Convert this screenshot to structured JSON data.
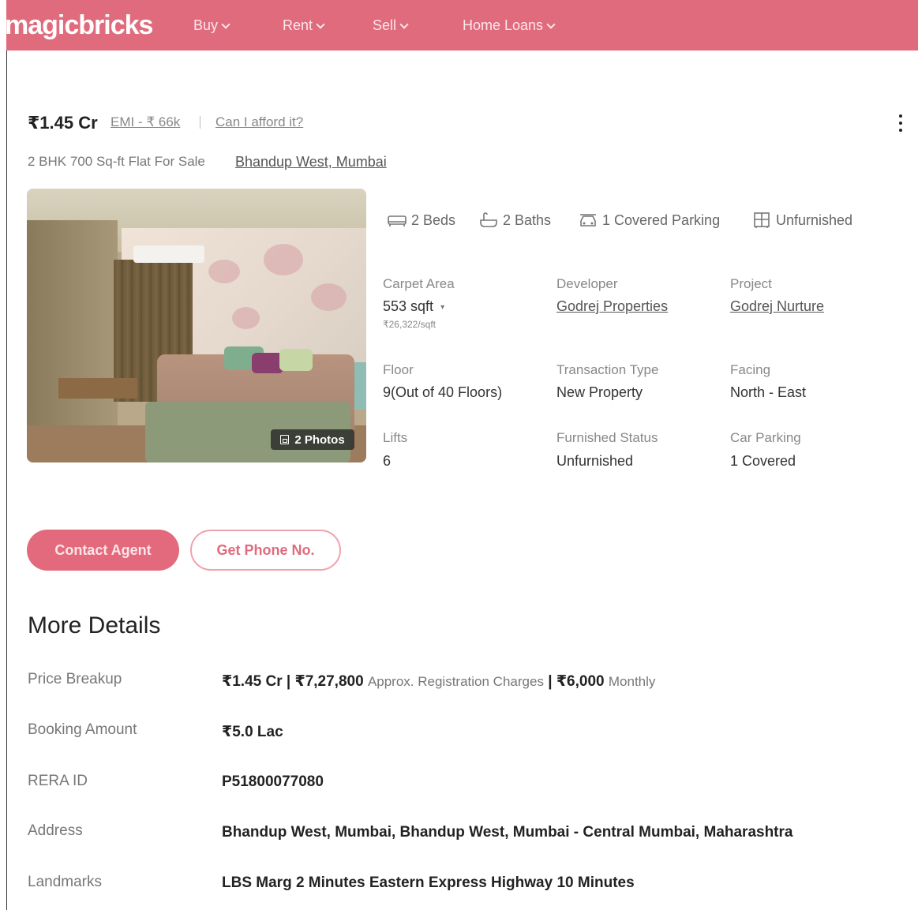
{
  "header": {
    "logo": "magicbricks",
    "nav": [
      {
        "label": "Buy"
      },
      {
        "label": "Rent"
      },
      {
        "label": "Sell"
      },
      {
        "label": "Home Loans"
      }
    ]
  },
  "listing": {
    "price": "₹1.45 Cr",
    "emi_link": "EMI - ₹ 66k",
    "afford_link": "Can I afford it?",
    "subtitle": "2 BHK 700 Sq-ft Flat For Sale",
    "locality_link": "Bhandup West, Mumbai",
    "photos_badge": "2 Photos"
  },
  "amenities": {
    "beds": "2 Beds",
    "baths": "2 Baths",
    "parking": "1 Covered Parking",
    "furnishing": "Unfurnished"
  },
  "specs": {
    "carpet_area_label": "Carpet Area",
    "carpet_area_value": "553 sqft",
    "carpet_area_rate": "₹26,322/sqft",
    "developer_label": "Developer",
    "developer_value": "Godrej Properties",
    "project_label": "Project",
    "project_value": "Godrej Nurture",
    "floor_label": "Floor",
    "floor_value": "9(Out of 40 Floors)",
    "transaction_label": "Transaction Type",
    "transaction_value": "New Property",
    "facing_label": "Facing",
    "facing_value": "North - East",
    "lifts_label": "Lifts",
    "lifts_value": "6",
    "furnished_label": "Furnished Status",
    "furnished_value": "Unfurnished",
    "car_parking_label": "Car Parking",
    "car_parking_value": "1 Covered"
  },
  "actions": {
    "contact_agent": "Contact Agent",
    "get_phone": "Get Phone No."
  },
  "more_details": {
    "title": "More Details",
    "price_breakup_label": "Price Breakup",
    "price_breakup_price": "₹1.45 Cr | ₹7,27,800",
    "price_breakup_reg": "Approx. Registration Charges",
    "price_breakup_monthly": "| ₹6,000",
    "price_breakup_monthly_label": "Monthly",
    "booking_label": "Booking Amount",
    "booking_value": "₹5.0 Lac",
    "rera_label": "RERA ID",
    "rera_value": "P51800077080",
    "address_label": "Address",
    "address_value": "Bhandup West, Mumbai, Bhandup West, Mumbai - Central Mumbai, Maharashtra",
    "landmarks_label": "Landmarks",
    "landmarks_value": "LBS Marg 2 Minutes Eastern Express Highway 10 Minutes"
  },
  "colors": {
    "brand": "#e06b7d",
    "text": "#222222",
    "muted": "#888888"
  }
}
